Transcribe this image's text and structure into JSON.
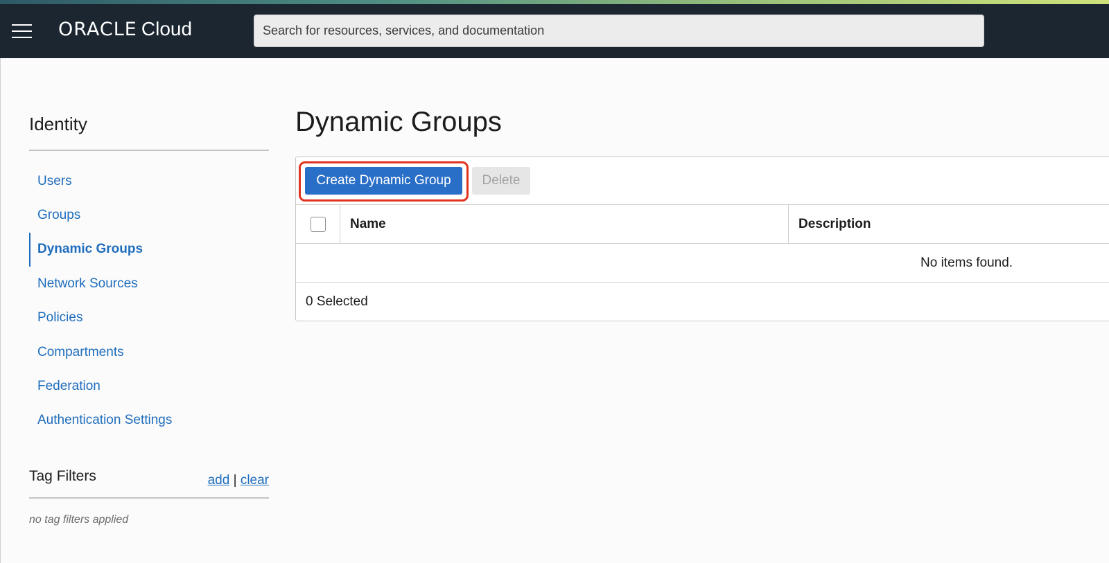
{
  "header": {
    "logo_brand": "ORACLE",
    "logo_product": "Cloud",
    "search_placeholder": "Search for resources, services, and documentation"
  },
  "sidebar": {
    "title": "Identity",
    "items": [
      {
        "label": "Users",
        "active": false
      },
      {
        "label": "Groups",
        "active": false
      },
      {
        "label": "Dynamic Groups",
        "active": true
      },
      {
        "label": "Network Sources",
        "active": false
      },
      {
        "label": "Policies",
        "active": false
      },
      {
        "label": "Compartments",
        "active": false
      },
      {
        "label": "Federation",
        "active": false
      },
      {
        "label": "Authentication Settings",
        "active": false
      }
    ],
    "tag_filters": {
      "title": "Tag Filters",
      "add_label": "add",
      "separator": "|",
      "clear_label": "clear",
      "empty_text": "no tag filters applied"
    }
  },
  "main": {
    "title": "Dynamic Groups",
    "toolbar": {
      "create_label": "Create Dynamic Group",
      "delete_label": "Delete"
    },
    "table": {
      "columns": [
        "Name",
        "Description"
      ],
      "empty_message": "No items found.",
      "selected_text": "0 Selected"
    }
  },
  "colors": {
    "header_bg": "#1b2631",
    "link": "#1f6dbd",
    "primary_button": "#2a6fc7",
    "highlight": "#e0321f"
  }
}
